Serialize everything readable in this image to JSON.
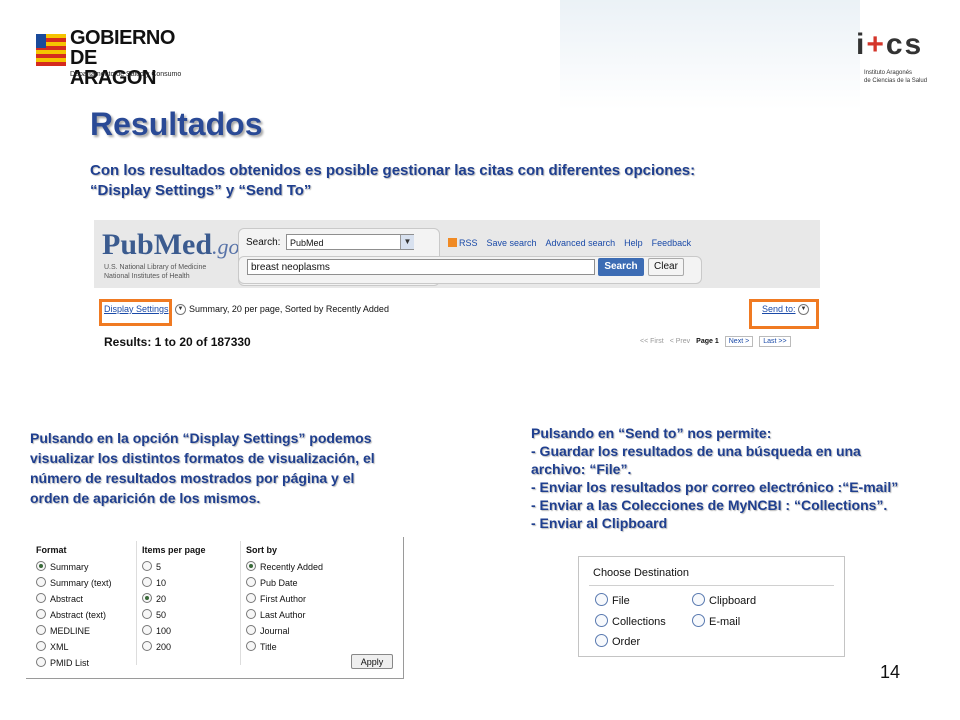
{
  "header": {
    "gobierno_line1": "GOBIERNO",
    "gobierno_line2": "DE ARAGON",
    "gobierno_dept": "Departamento de Salud y Consumo",
    "ics_mark_a": "i",
    "ics_mark_plus": "+",
    "ics_mark_b": "cs",
    "ics_sub1": "Instituto Aragonés",
    "ics_sub2": "de Ciencias de la Salud"
  },
  "slide": {
    "title": "Resultados",
    "intro_line1": "Con los resultados obtenidos es posible gestionar las citas con diferentes opciones:",
    "intro_line2": "“Display Settings”  y  “Send To”",
    "page_number": "14"
  },
  "pubmed": {
    "logo_main": "PubMed",
    "logo_gov": ".gov",
    "nlm_line1": "U.S. National Library of Medicine",
    "nlm_line2": "National Institutes of Health",
    "search_label": "Search:",
    "database_value": "PubMed",
    "links": [
      "RSS",
      "Save search",
      "Advanced search",
      "Help",
      "Feedback"
    ],
    "search_term": "breast neoplasms",
    "search_button": "Search",
    "clear_button": "Clear",
    "display_settings_link": "Display Settings",
    "display_summary": "Summary, 20 per page, Sorted by Recently Added",
    "send_to_link": "Send to:",
    "results_text": "Results: 1 to 20 of 187330",
    "pager": {
      "first": "<< First",
      "prev": "< Prev",
      "page": "Page 1",
      "next": "Next >",
      "last": "Last >>"
    },
    "highlight_color": "#f07a22"
  },
  "left_text": {
    "lines": [
      "Pulsando en la opción “Display Settings” podemos",
      "visualizar los distintos formatos de visualización, el",
      "número de resultados mostrados por página y el",
      "orden de aparición de los mismos."
    ]
  },
  "right_text": {
    "lines": [
      "Pulsando en “Send to” nos permite:",
      "- Guardar los resultados de una búsqueda en una",
      "archivo:    “File”.",
      "- Enviar los resultados  por correo electrónico :“E-mail”",
      "- Enviar a las Colecciones de MyNCBI : “Collections”.",
      "- Enviar al Clipboard"
    ]
  },
  "display_settings": {
    "format_header": "Format",
    "format_options": [
      "Summary",
      "Summary (text)",
      "Abstract",
      "Abstract (text)",
      "MEDLINE",
      "XML",
      "PMID List"
    ],
    "format_selected": "Summary",
    "items_header": "Items per page",
    "items_options": [
      "5",
      "10",
      "20",
      "50",
      "100",
      "200"
    ],
    "items_selected": "20",
    "sort_header": "Sort by",
    "sort_options": [
      "Recently Added",
      "Pub Date",
      "First Author",
      "Last Author",
      "Journal",
      "Title"
    ],
    "sort_selected": "Recently Added",
    "apply_button": "Apply"
  },
  "choose_destination": {
    "title": "Choose Destination",
    "options": {
      "file": "File",
      "clipboard": "Clipboard",
      "collections": "Collections",
      "email": "E-mail",
      "order": "Order"
    }
  }
}
